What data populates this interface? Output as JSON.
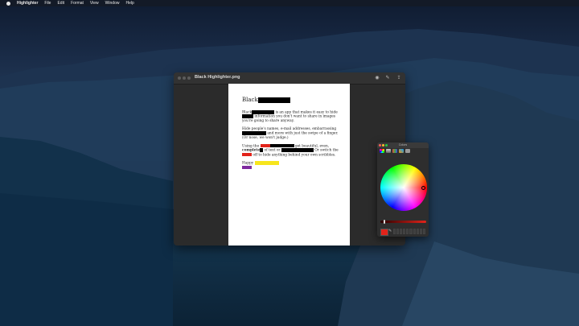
{
  "menubar": {
    "app_name": "Highlighter",
    "items": [
      "File",
      "Edit",
      "Format",
      "View",
      "Window",
      "Help"
    ]
  },
  "window": {
    "title": "Black Highlighter.png",
    "toolbar_icons": [
      "markup-icon",
      "share-icon"
    ]
  },
  "document": {
    "heading": "Black",
    "p1_a": "Black",
    "p1_b": " is an app that makes it easy to hide ",
    "p1_c": " information you don't want to share in images you're going to share anyway.",
    "p2_a": "Hide people's names, e-mail addresses, embarrassing ",
    "p2_b": " and more with just the swipe of a finger. (Or nose, we won't judge.)",
    "p3_a": "Using the ",
    "p3_b": " get beautiful, even,",
    "p3_c": "complete",
    "p3_d": " of text or ",
    "p3_e": "Or switch the ",
    "p3_f": " off to hide anything behind your own scribbles.",
    "p4_a": "Happy"
  },
  "colors_panel": {
    "title": "Colors",
    "selected_color": "#e2231a",
    "picker_glyph": "✎"
  },
  "colors": {
    "redaction_black": "#000000",
    "highlight_red": "#e2231a",
    "highlight_yellow": "#f7e51d",
    "highlight_purple": "#7e2a9e"
  }
}
